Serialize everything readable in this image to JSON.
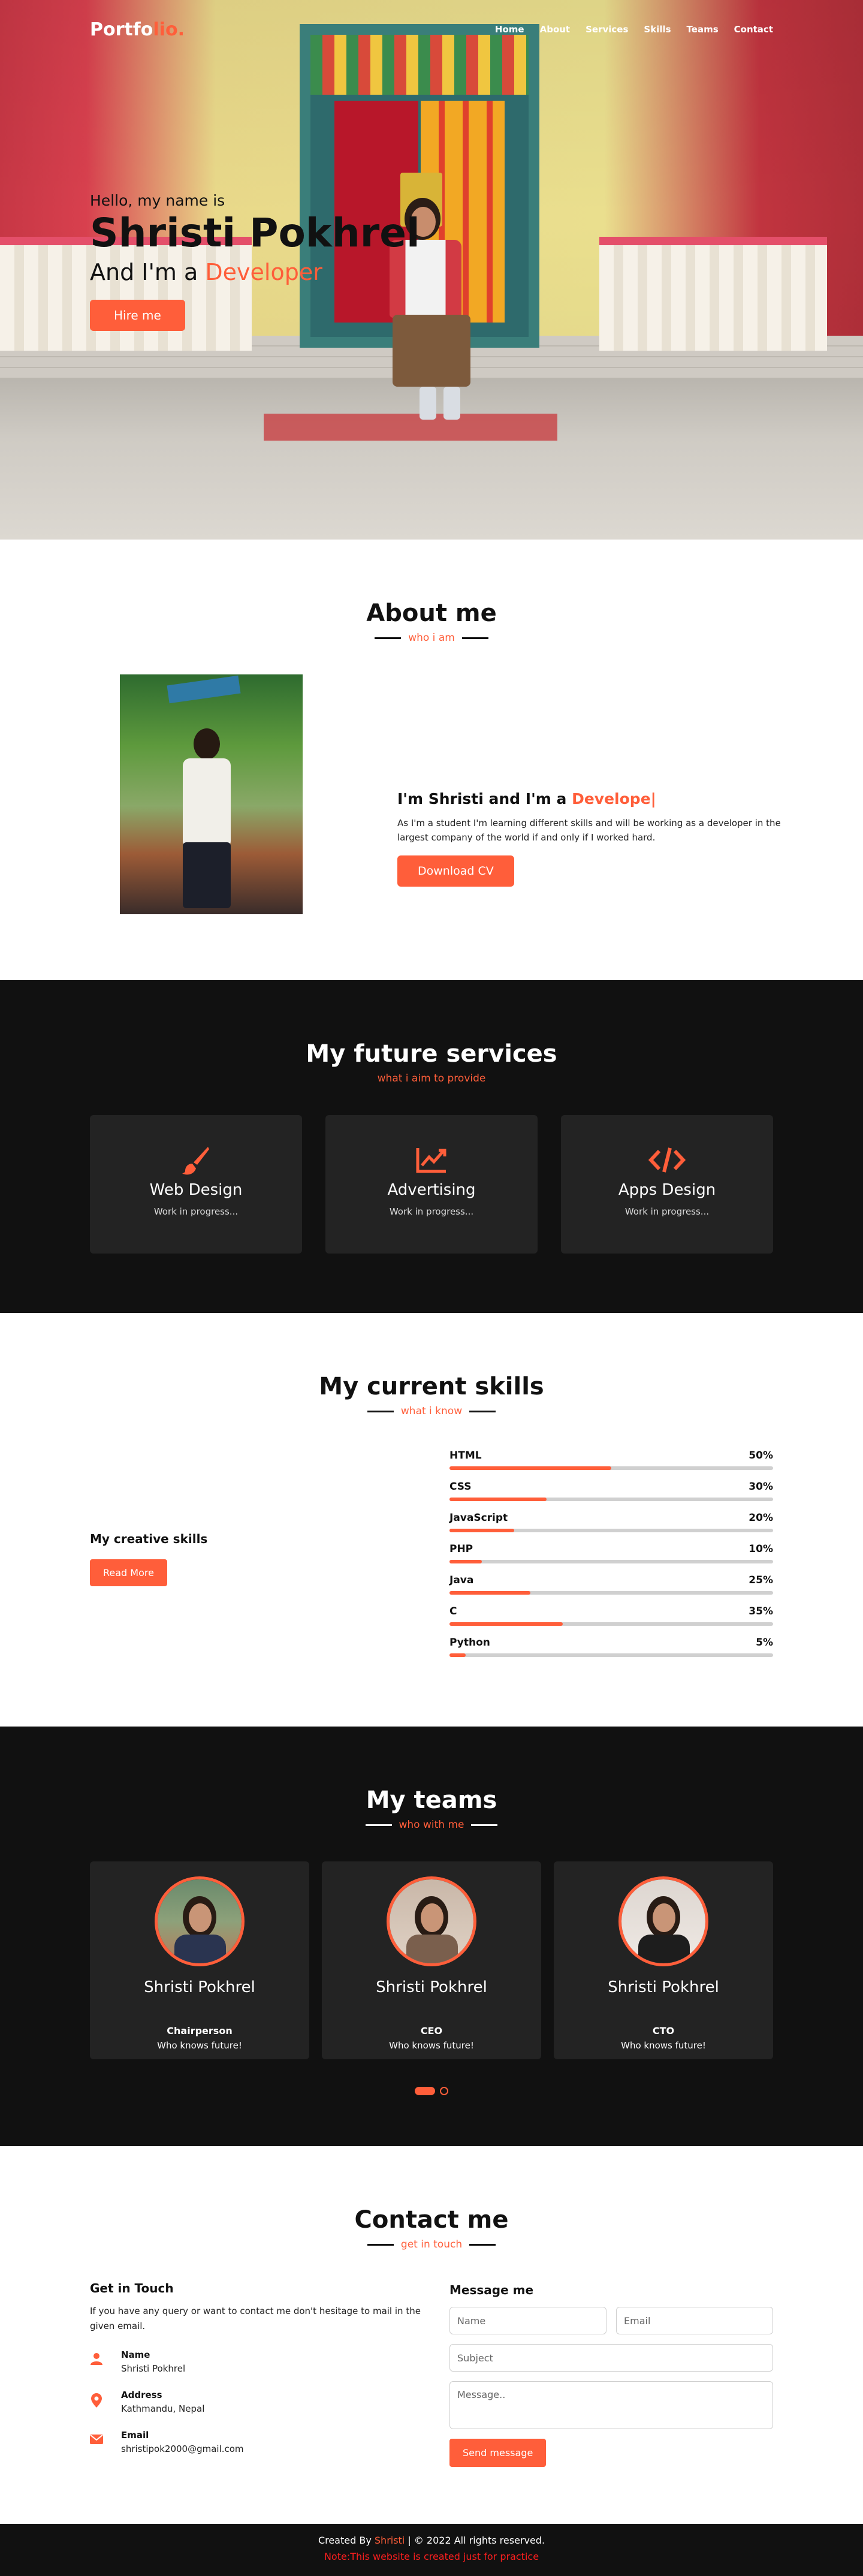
{
  "nav": {
    "logo_main": "Portfo",
    "logo_accent": "lio.",
    "items": [
      "Home",
      "About",
      "Services",
      "Skills",
      "Teams",
      "Contact"
    ]
  },
  "hero": {
    "greeting": "Hello, my name is",
    "name": "Shristi Pokhrel",
    "role_prefix": "And I'm a",
    "role_accent": "Developer",
    "button": "Hire me"
  },
  "about": {
    "title": "About me",
    "subtitle": "who i am",
    "heading_prefix": "I'm Shristi and I'm a",
    "heading_accent": "Develope|",
    "text": "As I'm a student I'm learning different skills and will be working as a developer in the largest company of the world if and only if I worked hard.",
    "button": "Download CV"
  },
  "services": {
    "title": "My future services",
    "subtitle": "what i aim to provide",
    "cards": [
      {
        "icon": "paint-brush-icon",
        "title": "Web Design",
        "text": "Work in progress..."
      },
      {
        "icon": "chart-line-icon",
        "title": "Advertising",
        "text": "Work in progress..."
      },
      {
        "icon": "code-icon",
        "title": "Apps Design",
        "text": "Work in progress..."
      }
    ]
  },
  "skills": {
    "title": "My current skills",
    "subtitle": "what i know",
    "left_heading": "My creative skills",
    "button": "Read More",
    "items": [
      {
        "name": "HTML",
        "label": "50%",
        "value": 50
      },
      {
        "name": "CSS",
        "label": "30%",
        "value": 30
      },
      {
        "name": "JavaScript",
        "label": "20%",
        "value": 20
      },
      {
        "name": "PHP",
        "label": "10%",
        "value": 10
      },
      {
        "name": "Java",
        "label": "25%",
        "value": 25
      },
      {
        "name": "C",
        "label": "35%",
        "value": 35
      },
      {
        "name": "Python",
        "label": "5%",
        "value": 5
      }
    ]
  },
  "teams": {
    "title": "My teams",
    "subtitle": "who with me",
    "members": [
      {
        "name": "Shristi Pokhrel",
        "position": "Chairperson",
        "desc": "Who knows future!"
      },
      {
        "name": "Shristi Pokhrel",
        "position": "CEO",
        "desc": "Who knows future!"
      },
      {
        "name": "Shristi Pokhrel",
        "position": "CTO",
        "desc": "Who knows future!"
      }
    ]
  },
  "contact": {
    "title": "Contact me",
    "subtitle": "get in touch",
    "left_heading": "Get in Touch",
    "left_text": "If you have any query or want to contact me don't hesitage to mail in the given email.",
    "items": [
      {
        "icon": "user-icon",
        "label": "Name",
        "value": "Shristi Pokhrel"
      },
      {
        "icon": "map-marker-icon",
        "label": "Address",
        "value": "Kathmandu, Nepal"
      },
      {
        "icon": "envelope-icon",
        "label": "Email",
        "value": "shristipok2000@gmail.com"
      }
    ],
    "right_heading": "Message me",
    "placeholders": {
      "name": "Name",
      "email": "Email",
      "subject": "Subject",
      "message": "Message.."
    },
    "button": "Send message"
  },
  "footer": {
    "created_prefix": "Created By",
    "created_name": "Shristi",
    "created_suffix": "| © 2022 All rights reserved.",
    "note": "Note:This website is created just for practice"
  },
  "colors": {
    "accent": "#ff5e3a",
    "dark": "#111111",
    "card": "#232323"
  }
}
